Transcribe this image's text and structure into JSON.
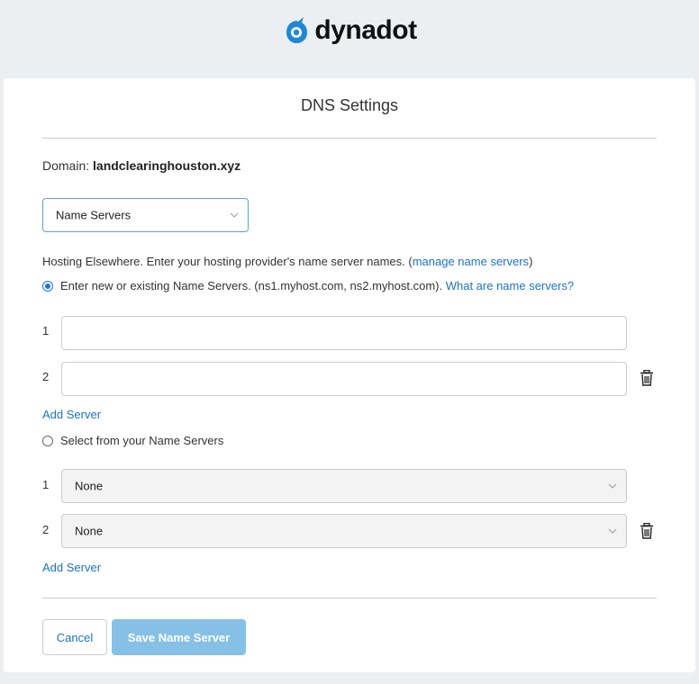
{
  "brand": {
    "name": "dynadot",
    "color": "#1e88d6"
  },
  "page": {
    "title": "DNS Settings"
  },
  "domain": {
    "label": "Domain:",
    "value": "landclearinghouston.xyz"
  },
  "dns_type_select": {
    "value": "Name Servers"
  },
  "hosting": {
    "text": "Hosting Elsewhere. Enter your hosting provider's name server names. (",
    "link": "manage name servers",
    "close": ")"
  },
  "option_new": {
    "selected": true,
    "text": "Enter new or existing Name Servers. (ns1.myhost.com, ns2.myhost.com).",
    "link": "What are name servers?"
  },
  "new_servers": [
    {
      "num": "1",
      "value": ""
    },
    {
      "num": "2",
      "value": ""
    }
  ],
  "add_server_label": "Add Server",
  "option_select": {
    "selected": false,
    "text": "Select from your Name Servers"
  },
  "existing_servers": [
    {
      "num": "1",
      "value": "None"
    },
    {
      "num": "2",
      "value": "None"
    }
  ],
  "buttons": {
    "cancel": "Cancel",
    "save": "Save Name Server"
  }
}
